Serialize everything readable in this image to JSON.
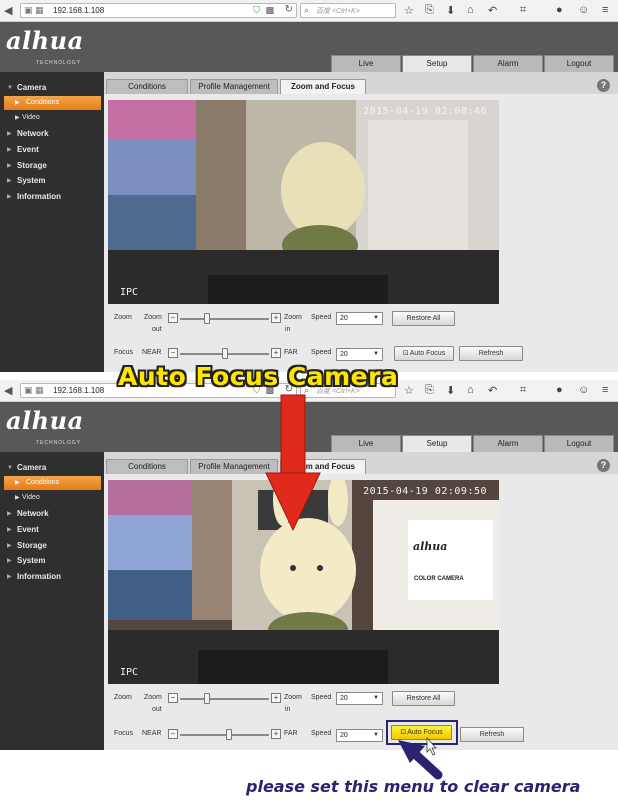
{
  "browser": {
    "url": "192.168.1.108",
    "search_placeholder": "百度 <Ctrl+K>"
  },
  "app": {
    "logo_text": "alhua",
    "logo_sub": "TECHNOLOGY",
    "nav_tabs": [
      "Live",
      "Setup",
      "Alarm",
      "Logout"
    ],
    "active_nav": "Setup"
  },
  "sidebar": {
    "items": [
      {
        "label": "Camera",
        "level": 0,
        "active": false
      },
      {
        "label": "Conditions",
        "level": 1,
        "active": true
      },
      {
        "label": "Video",
        "level": 1,
        "active": false
      },
      {
        "label": "Network",
        "level": 0,
        "active": false
      },
      {
        "label": "Event",
        "level": 0,
        "active": false
      },
      {
        "label": "Storage",
        "level": 0,
        "active": false
      },
      {
        "label": "System",
        "level": 0,
        "active": false
      },
      {
        "label": "Information",
        "level": 0,
        "active": false
      }
    ]
  },
  "subtabs": [
    "Conditions",
    "Profile Management",
    "Zoom and Focus"
  ],
  "active_subtab": "Zoom and Focus",
  "top": {
    "timestamp": "2015-04-19 02:08:46",
    "cam_label": "IPC"
  },
  "bottom": {
    "timestamp": "2015-04-19 02:09:50",
    "cam_label": "IPC",
    "box_brand": "alhua",
    "box_label": "COLOR CAMERA"
  },
  "controls": {
    "zoom_label": "Zoom",
    "zoom_out_label": "Zoom",
    "zoom_out_sub": "out",
    "zoom_in_label": "Zoom",
    "zoom_in_sub": "in",
    "focus_label": "Focus",
    "near_label": "NEAR",
    "far_label": "FAR",
    "speed_label": "Speed",
    "zoom_speed": "20",
    "focus_speed": "20",
    "restore_all": "Restore All",
    "auto_focus": "Auto Focus",
    "refresh": "Refresh",
    "top_zoom_position": 0.3,
    "top_focus_position": 0.5,
    "bottom_zoom_position": 0.3,
    "bottom_focus_position": 0.55
  },
  "overlay": {
    "banner": "Auto Focus Camera",
    "caption": "please set this menu to clear camera",
    "arrow_color": "#e02a1c",
    "caption_color": "#2a2370",
    "highlight_color": "#2a2370"
  }
}
